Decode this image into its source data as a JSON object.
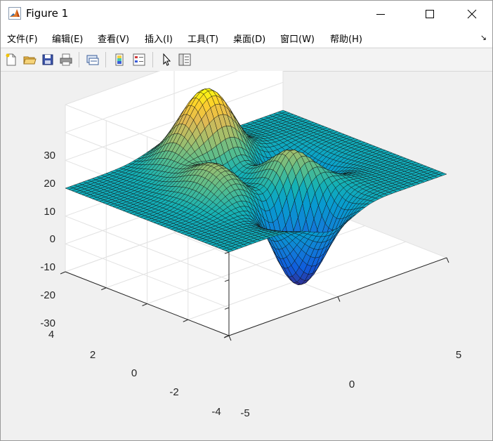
{
  "window": {
    "title": "Figure 1",
    "icon": "matlab-logo-icon",
    "controls": [
      "minimize-icon",
      "maximize-icon",
      "close-icon"
    ]
  },
  "menu": {
    "items": [
      "文件(F)",
      "编辑(E)",
      "查看(V)",
      "插入(I)",
      "工具(T)",
      "桌面(D)",
      "窗口(W)",
      "帮助(H)"
    ],
    "corner": "↘"
  },
  "toolbar": {
    "tools": [
      "new-figure-icon",
      "open-file-icon",
      "save-icon",
      "print-icon",
      "link-plot-icon",
      "colorbar-icon",
      "legend-icon",
      "pointer-icon",
      "property-inspector-icon"
    ]
  },
  "chart_data": {
    "type": "surface",
    "function": "peaks",
    "x_range": [
      -5,
      5
    ],
    "y_range": [
      -4,
      4
    ],
    "z_range": [
      -30,
      30
    ],
    "z_ticks": [
      "30",
      "20",
      "10",
      "0",
      "-10",
      "-20",
      "-30"
    ],
    "y_ticks": [
      "4",
      "2",
      "0",
      "-2",
      "-4"
    ],
    "x_ticks": [
      "-5",
      "0",
      "5"
    ],
    "peak_max": 26,
    "peak_min": -29,
    "colormap": "parula",
    "grid": true,
    "box": false
  }
}
